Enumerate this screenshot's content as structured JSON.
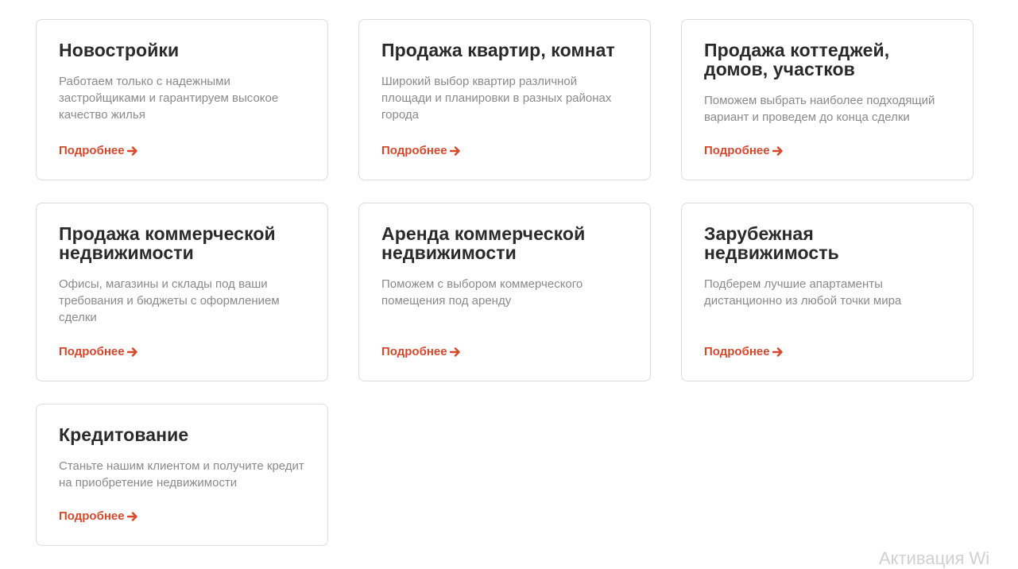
{
  "cards": [
    {
      "title": "Новостройки",
      "description": "Работаем только с надежными застройщиками и гарантируем высокое качество жилья",
      "link": "Подробнее"
    },
    {
      "title": "Продажа квартир, комнат",
      "description": "Широкий выбор квартир различной площади и планировки в разных районах города",
      "link": "Подробнее"
    },
    {
      "title": "Продажа коттеджей, домов, участков",
      "description": "Поможем выбрать наиболее подходящий вариант и проведем до конца сделки",
      "link": "Подробнее"
    },
    {
      "title": "Продажа коммерческой недвижимости",
      "description": "Офисы, магазины и склады под ваши требования и бюджеты с оформлением сделки",
      "link": "Подробнее"
    },
    {
      "title": "Аренда коммерческой недвижимости",
      "description": "Поможем с выбором коммерческого помещения под аренду",
      "link": "Подробнее"
    },
    {
      "title": "Зарубежная недвижимость",
      "description": "Подберем лучшие апартаменты дистанционно из любой точки мира",
      "link": "Подробнее"
    },
    {
      "title": "Кредитование",
      "description": "Станьте нашим клиентом и получите кредит на приобретение недвижимости",
      "link": "Подробнее"
    }
  ],
  "icons": {
    "link_arrow": "arrow-right-icon"
  },
  "colors": {
    "accent": "#d9472b",
    "title": "#2a2a2a",
    "text": "#8a8a8a",
    "border": "#dcdcdc"
  },
  "watermark": {
    "text": "Активация Wi"
  }
}
